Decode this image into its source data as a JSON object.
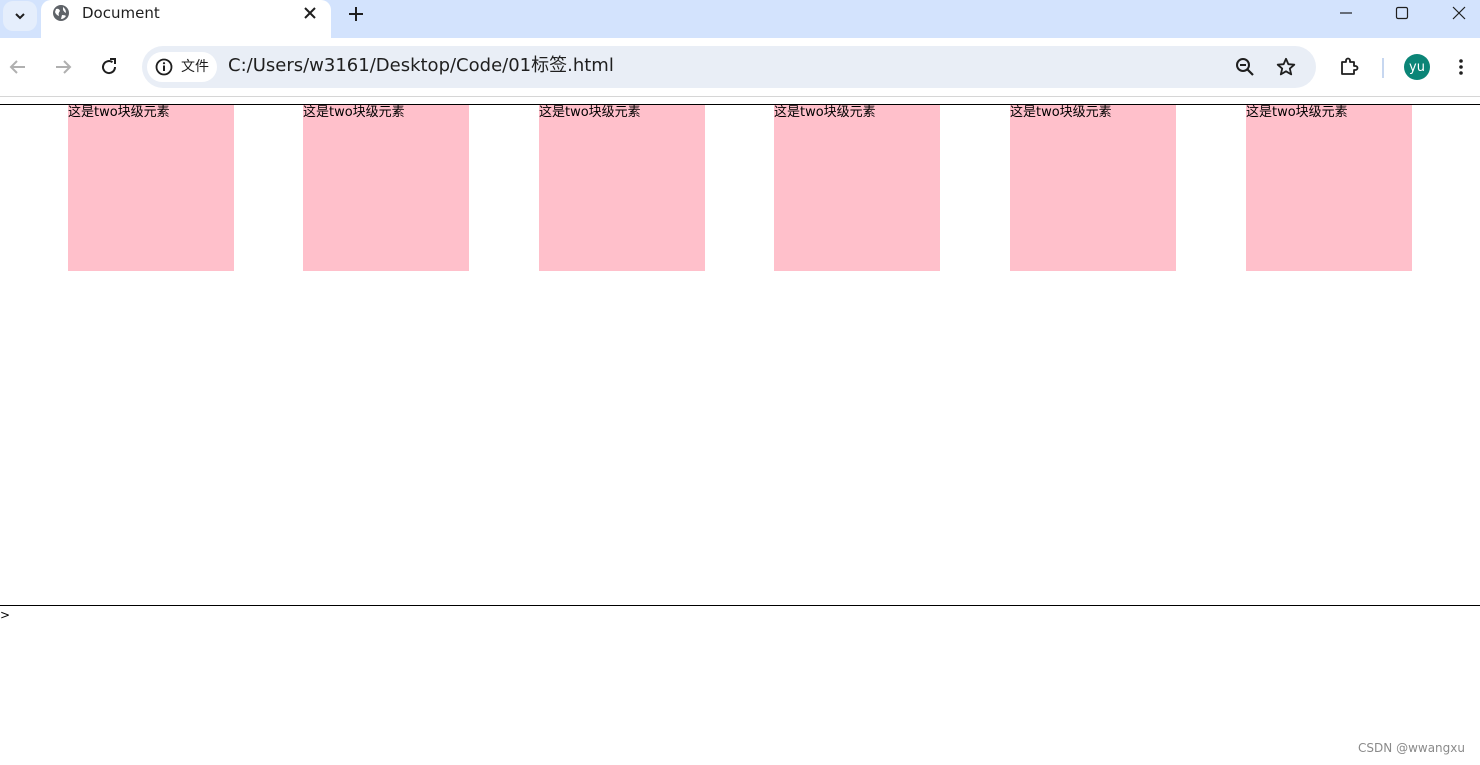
{
  "browser": {
    "tab": {
      "title": "Document",
      "favicon": "globe-icon"
    },
    "omnibox": {
      "chip_label": "文件",
      "url": "C:/Users/w3161/Desktop/Code/01标签.html"
    },
    "profile_initials": "yu",
    "colors": {
      "tabstrip": "#d3e3fd",
      "omnibox": "#e9eef6",
      "avatar": "#0b8577"
    }
  },
  "page": {
    "boxes": [
      {
        "text": "这是two块级元素"
      },
      {
        "text": "这是two块级元素"
      },
      {
        "text": "这是two块级元素"
      },
      {
        "text": "这是two块级元素"
      },
      {
        "text": "这是two块级元素"
      },
      {
        "text": "这是two块级元素"
      }
    ],
    "box_color": "#ffc0cb",
    "stray_text": ">",
    "watermark": "CSDN @wwangxu"
  }
}
